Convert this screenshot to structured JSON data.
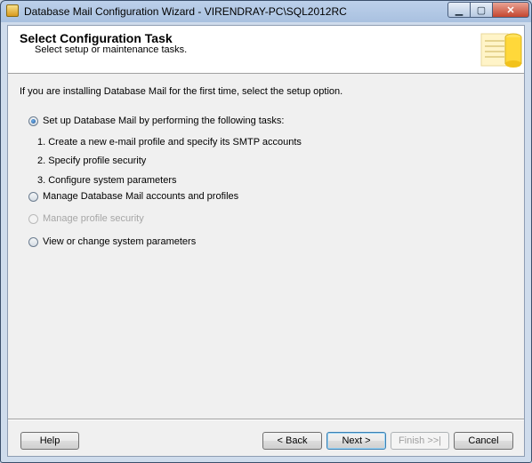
{
  "window": {
    "title": "Database Mail Configuration Wizard - VIRENDRAY-PC\\SQL2012RC",
    "minimize_glyph": "▁",
    "maximize_glyph": "▢",
    "close_glyph": "✕"
  },
  "banner": {
    "title": "Select Configuration Task",
    "subtitle": "Select setup or maintenance tasks.",
    "art_icon": "database-wizard-icon"
  },
  "intro_text": "If you are installing Database Mail for the first time, select the setup option.",
  "options": {
    "setup": {
      "label": "Set up Database Mail by performing the following tasks:",
      "selected": true,
      "enabled": true
    },
    "manage_accounts": {
      "label": "Manage Database Mail accounts and profiles",
      "selected": false,
      "enabled": true
    },
    "manage_security": {
      "label": "Manage profile security",
      "selected": false,
      "enabled": false
    },
    "system_params": {
      "label": "View or change system parameters",
      "selected": false,
      "enabled": true
    }
  },
  "setup_tasks": [
    "1. Create a new e-mail profile and specify its SMTP accounts",
    "2. Specify profile security",
    "3. Configure system parameters"
  ],
  "buttons": {
    "help": "Help",
    "back": "< Back",
    "next": "Next >",
    "finish": "Finish >>|",
    "cancel": "Cancel"
  }
}
